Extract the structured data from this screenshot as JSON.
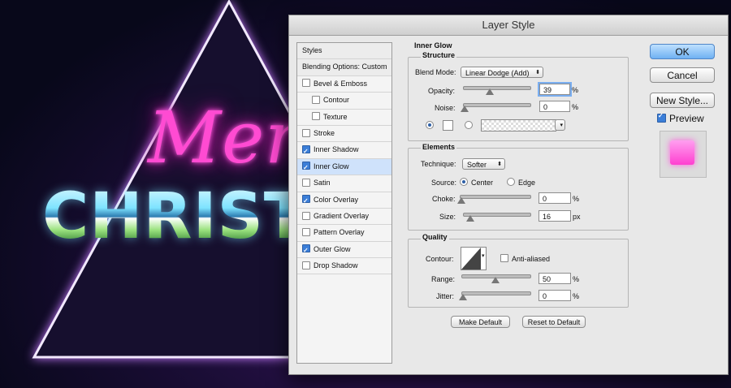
{
  "artwork": {
    "merry_text": "Merr",
    "christmas_text": "CHRIST"
  },
  "dialog": {
    "title": "Layer Style",
    "styles_list": {
      "header": "Styles",
      "blending": "Blending Options: Custom",
      "items": [
        {
          "label": "Bevel & Emboss",
          "checked": false
        },
        {
          "label": "Contour",
          "checked": false
        },
        {
          "label": "Texture",
          "checked": false
        },
        {
          "label": "Stroke",
          "checked": false
        },
        {
          "label": "Inner Shadow",
          "checked": true
        },
        {
          "label": "Inner Glow",
          "checked": true,
          "selected": true
        },
        {
          "label": "Satin",
          "checked": false
        },
        {
          "label": "Color Overlay",
          "checked": true
        },
        {
          "label": "Gradient Overlay",
          "checked": false
        },
        {
          "label": "Pattern Overlay",
          "checked": false
        },
        {
          "label": "Outer Glow",
          "checked": true
        },
        {
          "label": "Drop Shadow",
          "checked": false
        }
      ]
    },
    "inner_glow": {
      "title": "Inner Glow",
      "structure": {
        "title": "Structure",
        "blend_mode_label": "Blend Mode:",
        "blend_mode_value": "Linear Dodge (Add)",
        "opacity_label": "Opacity:",
        "opacity_value": "39",
        "opacity_unit": "%",
        "noise_label": "Noise:",
        "noise_value": "0",
        "noise_unit": "%"
      },
      "elements": {
        "title": "Elements",
        "technique_label": "Technique:",
        "technique_value": "Softer",
        "source_label": "Source:",
        "source_center": "Center",
        "source_edge": "Edge",
        "choke_label": "Choke:",
        "choke_value": "0",
        "choke_unit": "%",
        "size_label": "Size:",
        "size_value": "16",
        "size_unit": "px"
      },
      "quality": {
        "title": "Quality",
        "contour_label": "Contour:",
        "anti_aliased_label": "Anti-aliased",
        "range_label": "Range:",
        "range_value": "50",
        "range_unit": "%",
        "jitter_label": "Jitter:",
        "jitter_value": "0",
        "jitter_unit": "%"
      },
      "make_default": "Make Default",
      "reset_default": "Reset to Default"
    },
    "buttons": {
      "ok": "OK",
      "cancel": "Cancel",
      "new_style": "New Style...",
      "preview": "Preview"
    },
    "colors": {
      "preview_swatch": "#ff3fd0",
      "accent": "#3b7ed8"
    }
  }
}
